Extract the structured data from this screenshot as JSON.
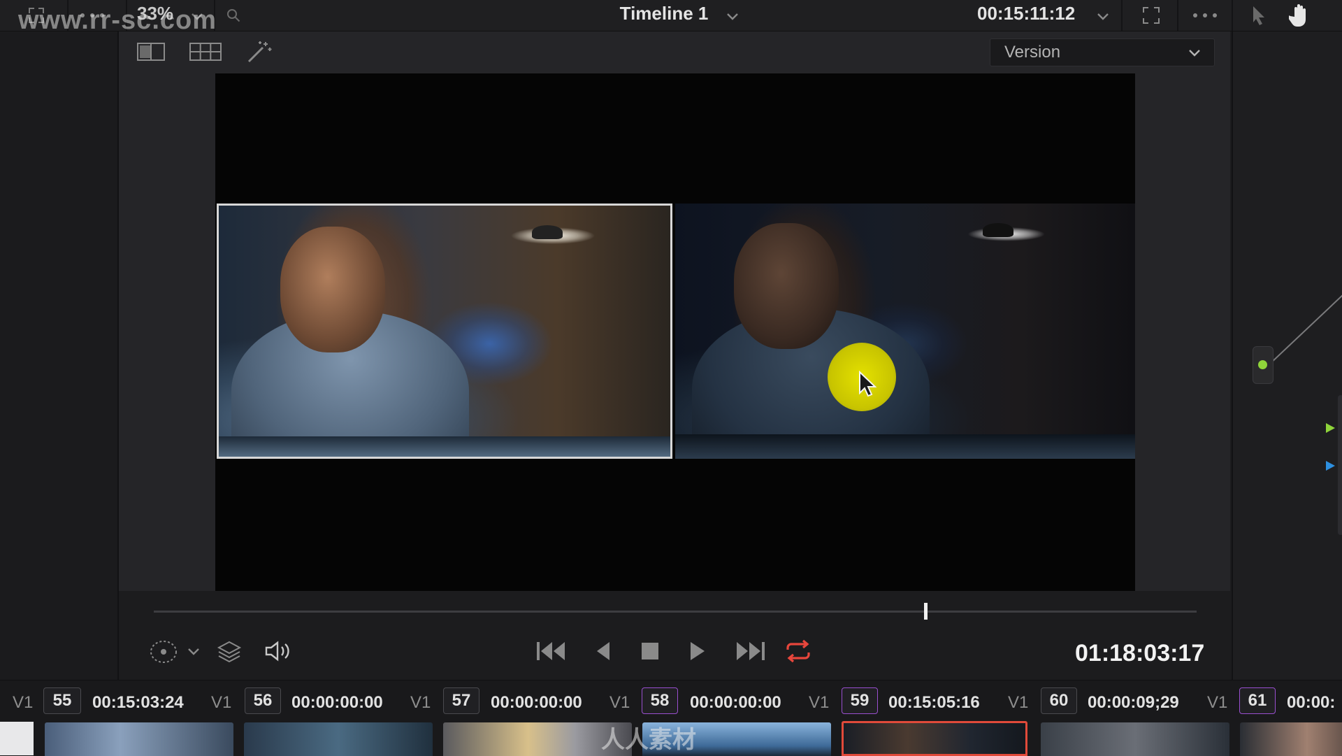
{
  "watermark": {
    "url": "www.rr-sc.com",
    "logo": "人人素材"
  },
  "topbar": {
    "zoom": "33%",
    "timeline_title": "Timeline 1",
    "timecode": "00:15:11:12",
    "icons": [
      "expand-icon",
      "more-icon",
      "chevron-down-icon",
      "search-icon",
      "fullscreen-icon",
      "more-icon",
      "pointer-icon",
      "hand-icon"
    ]
  },
  "viewer": {
    "version_label": "Version",
    "toolbar_icons": [
      "split-view-icon",
      "gallery-grid-icon",
      "magic-wand-icon"
    ]
  },
  "transport": {
    "timecode": "01:18:03:17",
    "controls": [
      "first-frame-icon",
      "step-back-icon",
      "stop-icon",
      "play-icon",
      "last-frame-icon",
      "loop-icon"
    ],
    "loop_color": "#e8463c",
    "scrub_position": 0.74
  },
  "clips": [
    {
      "track": "V1",
      "num": "55",
      "timecode": "00:15:03:24",
      "num_border": "#4a4a4e"
    },
    {
      "track": "V1",
      "num": "56",
      "timecode": "00:00:00:00",
      "num_border": "#4a4a4e"
    },
    {
      "track": "V1",
      "num": "57",
      "timecode": "00:00:00:00",
      "num_border": "#4a4a4e"
    },
    {
      "track": "V1",
      "num": "58",
      "timecode": "00:00:00:00",
      "num_border": "#9a4fd0"
    },
    {
      "track": "V1",
      "num": "59",
      "timecode": "00:15:05:16",
      "num_border": "#9a4fd0"
    },
    {
      "track": "V1",
      "num": "60",
      "timecode": "00:00:09;29",
      "num_border": "#4a4a4e"
    },
    {
      "track": "V1",
      "num": "61",
      "timecode": "00:00:",
      "num_border": "#9a4fd0"
    }
  ],
  "colors": {
    "accent_selected_clip": "#e04a3a",
    "node_green": "#8fd43a",
    "node_blue": "#2d8fe0"
  }
}
